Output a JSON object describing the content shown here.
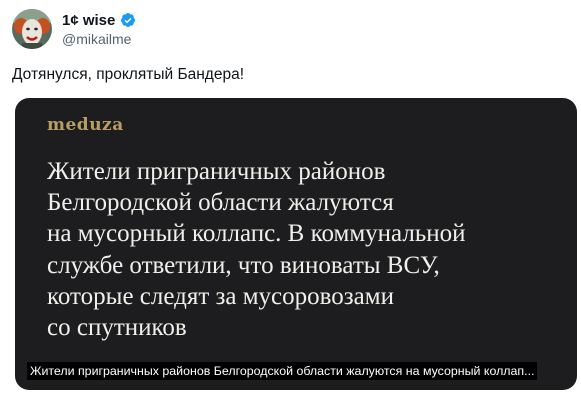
{
  "author": {
    "display_name": "1¢ wise",
    "handle": "@mikailme",
    "verified": true
  },
  "tweet": {
    "text": "Дотянулся, проклятый Бандера!"
  },
  "media": {
    "brand": "meduza",
    "headline_lines": [
      "Жители приграничных районов",
      "Белгородской области жалуются",
      "на мусорный коллапс. В коммунальной",
      "службе ответили, что виноваты ВСУ,",
      "которые следят за мусоровозами",
      "со спутников"
    ],
    "alt_caption": "Жители приграничных районов Белгородской области жалуются на мусорный коллап..."
  },
  "icons": {
    "avatar": "clown-avatar",
    "verified": "verified-badge-icon"
  },
  "colors": {
    "card_background": "#1d1d1f",
    "brand": "#b89e62",
    "headline": "#f1efeb",
    "verified": "#1d9bf0",
    "handle": "#536471"
  }
}
